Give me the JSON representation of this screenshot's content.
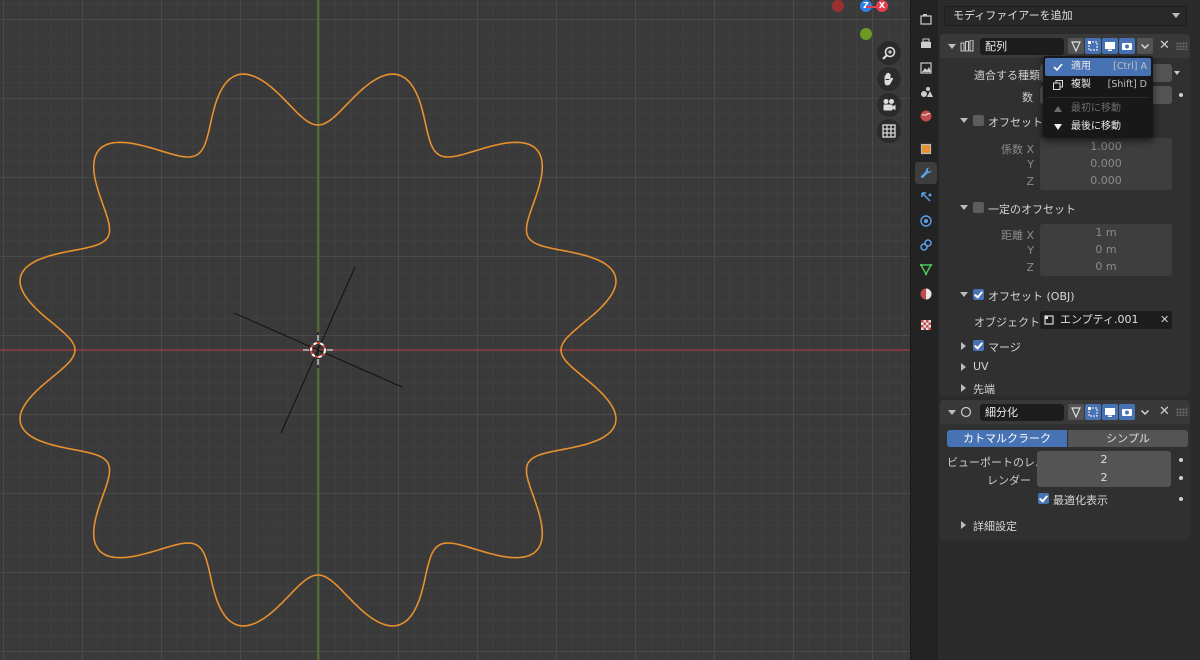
{
  "colors": {
    "accent": "#4772b3",
    "curve": "#e8902e",
    "x_axis": "#a33a3a",
    "y_axis": "#5f8a2a",
    "gizmo_x": "#e33e4f",
    "gizmo_z": "#2f7fe8",
    "gizmo_y": "#6a9a23"
  },
  "viewport": {
    "gizmo": {
      "z_label": "Z",
      "x_label": "X"
    },
    "nav_icons": [
      "zoom-icon",
      "hand-icon",
      "camera-icon",
      "grid-icon"
    ]
  },
  "property_tabs": [
    "render-icon",
    "output-icon",
    "view-layer-icon",
    "scene-icon",
    "world-icon",
    "object-icon",
    "wrench-icon",
    "particles-icon",
    "physics-icon",
    "constraints-icon",
    "data-icon",
    "material-icon",
    "texture-icon"
  ],
  "properties": {
    "add_modifier": "モディファイアーを追加",
    "array": {
      "name": "配列",
      "fit_type_label": "適合する種類",
      "count_label": "数",
      "relative_offset": "オフセット (倍",
      "factor_x_label": "係数 X",
      "y_label": "Y",
      "z_label": "Z",
      "factor_x": "1.000",
      "factor_y": "0.000",
      "factor_z": "0.000",
      "constant_offset": "一定のオフセット",
      "distance_x_label": "距離 X",
      "distance_x": "1 m",
      "distance_y": "0 m",
      "distance_z": "0 m",
      "object_offset": "オフセット (OBJ)",
      "object_label": "オブジェクト",
      "object_value": "エンプティ.001",
      "merge": "マージ",
      "uv": "UV",
      "caps": "先端"
    },
    "subsurf": {
      "name": "細分化",
      "catmull": "カトマルクラーク",
      "simple": "シンプル",
      "viewport_label": "ビューポートのレ...",
      "viewport_value": "2",
      "render_label": "レンダー",
      "render_value": "2",
      "optimal": "最適化表示",
      "advanced": "詳細設定"
    }
  },
  "dropdown": {
    "apply": "適用",
    "apply_shortcut": "[Ctrl] A",
    "duplicate": "複製",
    "duplicate_shortcut": "[Shift] D",
    "move_first": "最初に移動",
    "move_last": "最後に移動"
  }
}
